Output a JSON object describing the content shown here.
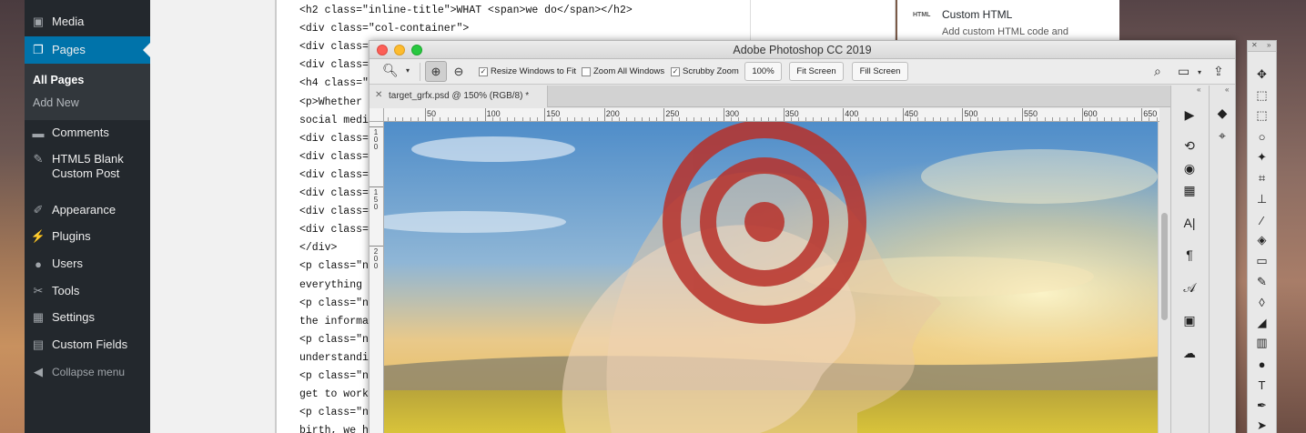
{
  "wp": {
    "menu": {
      "media": "Media",
      "pages": "Pages",
      "all_pages": "All Pages",
      "add_new": "Add New",
      "comments": "Comments",
      "html5_line1": "HTML5 Blank",
      "html5_line2": "Custom Post",
      "appearance": "Appearance",
      "plugins": "Plugins",
      "users": "Users",
      "tools": "Tools",
      "settings": "Settings",
      "custom_fields": "Custom Fields",
      "collapse": "Collapse menu"
    },
    "code_lines": [
      "<h2 class=\"inline-title\">WHAT <span>we do</span></h2>",
      "<div class=\"col-container\">",
      "<div class=",
      "<div class=",
      "<h4 class=\"",
      "<p>Whether ",
      "social medi",
      "<div class=",
      "<div class=",
      "<div class=",
      "<div class=",
      "<div class=",
      "<div class=",
      "</div>",
      "<p class=\"no",
      "everything ",
      "<p class=\"no",
      "the informa",
      "<p class=\"no",
      "understandi",
      "<p class=\"no",
      "get to work",
      "<p class=\"no",
      "birth, we h"
    ],
    "widget": {
      "badge": "HTML",
      "title": "Custom HTML",
      "desc": "Add custom HTML code and"
    }
  },
  "ps": {
    "title": "Adobe Photoshop CC 2019",
    "options": {
      "resize_windows": "Resize Windows to Fit",
      "zoom_all": "Zoom All Windows",
      "scrubby_zoom": "Scrubby Zoom",
      "zoom_level": "100%",
      "fit_screen": "Fit Screen",
      "fill_screen": "Fill Screen",
      "resize_checked": true,
      "zoom_all_checked": false,
      "scrubby_checked": true
    },
    "doc_tab": "target_grfx.psd @ 150% (RGB/8) *",
    "ruler_h": [
      "50",
      "100",
      "150",
      "200",
      "250",
      "300",
      "350",
      "400",
      "450",
      "500",
      "550",
      "600",
      "650"
    ],
    "ruler_v": [
      "100",
      "150",
      "200"
    ]
  }
}
